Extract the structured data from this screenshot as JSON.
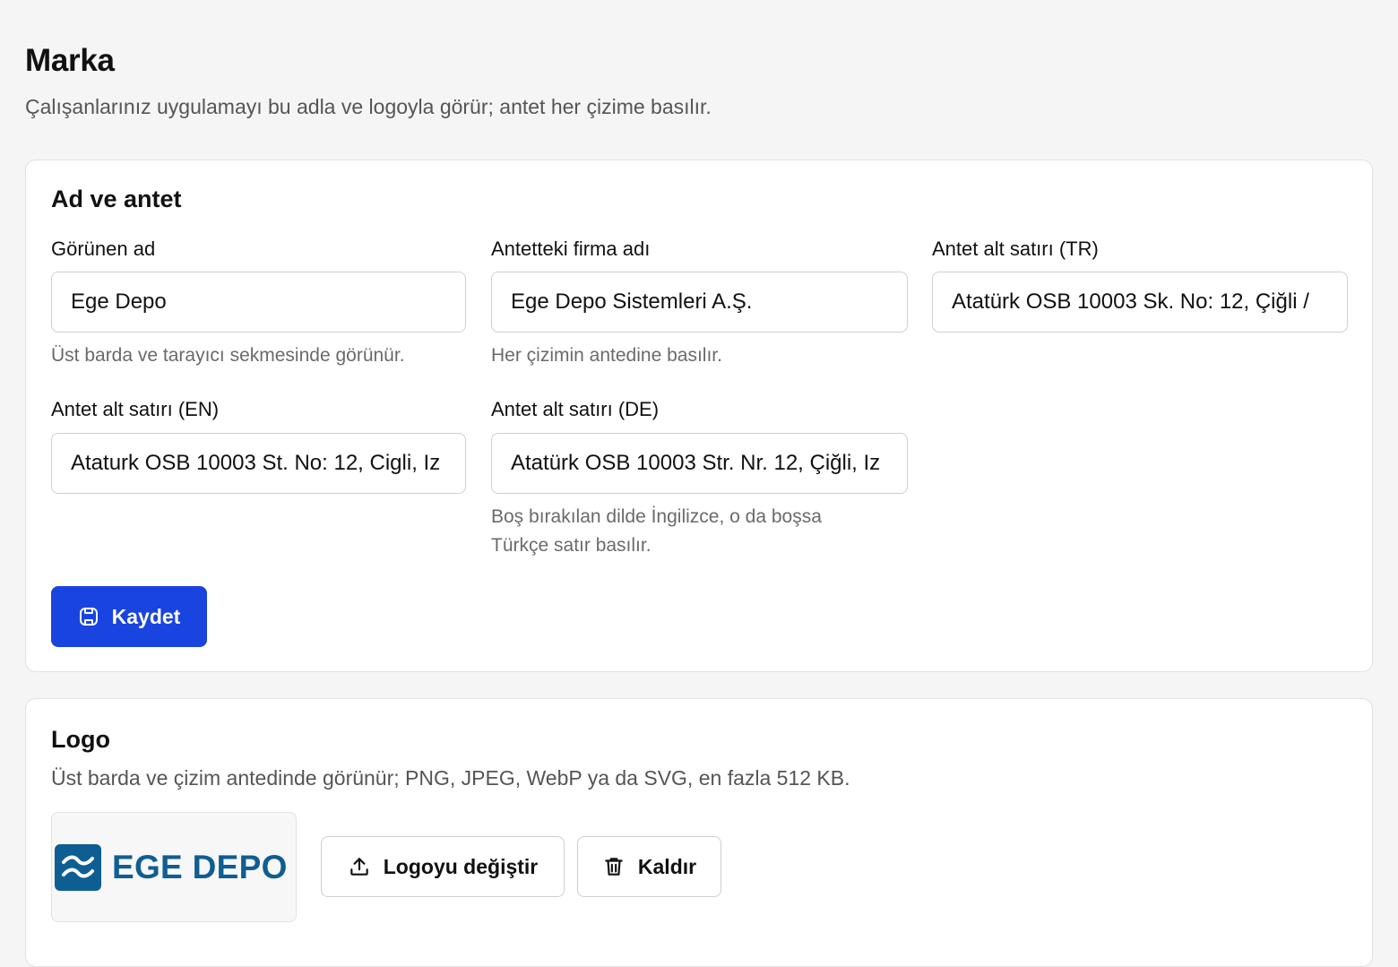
{
  "page": {
    "title": "Marka",
    "subtitle": "Çalışanlarınız uygulamayı bu adla ve logoyla görür; antet her çizime basılır."
  },
  "name_card": {
    "title": "Ad ve antet",
    "display_name": {
      "label": "Görünen ad",
      "value": "Ege Depo",
      "hint": "Üst barda ve tarayıcı sekmesinde görünür."
    },
    "company_name": {
      "label": "Antetteki firma adı",
      "value": "Ege Depo Sistemleri A.Ş.",
      "hint": "Her çizimin antedine basılır."
    },
    "subline_tr": {
      "label": "Antet alt satırı (TR)",
      "value": "Atatürk OSB 10003 Sk. No: 12, Çiğli /"
    },
    "subline_en": {
      "label": "Antet alt satırı (EN)",
      "value": "Ataturk OSB 10003 St. No: 12, Cigli, Iz"
    },
    "subline_de": {
      "label": "Antet alt satırı (DE)",
      "value": "Atatürk OSB 10003 Str. Nr. 12, Çiğli, Iz",
      "hint_line1": "Boş bırakılan dilde İngilizce, o da boşsa",
      "hint_line2": "Türkçe satır basılır."
    },
    "save_label": "Kaydet",
    "save_icon": "save-icon"
  },
  "logo_card": {
    "title": "Logo",
    "description": "Üst barda ve çizim antedinde görünür; PNG, JPEG, WebP ya da SVG, en fazla 512 KB.",
    "logo_text": "EGE DEPO",
    "logo_color": "#0f5e93",
    "change_label": "Logoyu değiştir",
    "change_icon": "upload-icon",
    "remove_label": "Kaldır",
    "remove_icon": "trash-icon"
  },
  "colors": {
    "primary": "#1a44e0",
    "background": "#f5f5f5",
    "card": "#ffffff"
  }
}
